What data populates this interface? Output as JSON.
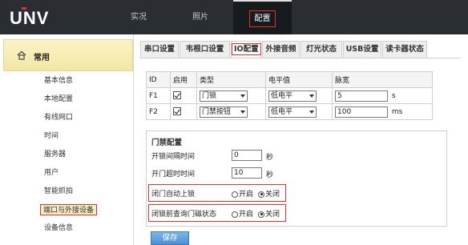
{
  "brand": {
    "logo_text": "UNV",
    "accent": "#e4322b",
    "topbar_bg": "#2a2e33"
  },
  "top_nav": [
    {
      "label": "实况"
    },
    {
      "label": "照片"
    },
    {
      "label": "配置",
      "active": true
    }
  ],
  "sidebar": {
    "header": {
      "icon": "home-icon",
      "label": "常用"
    },
    "items": [
      {
        "label": "基本信息"
      },
      {
        "label": "本地配置"
      },
      {
        "label": "有线网口"
      },
      {
        "label": "时间"
      },
      {
        "label": "服务器"
      },
      {
        "label": "用户"
      },
      {
        "label": "智能抓拍"
      },
      {
        "label": "端口与外接设备",
        "active": true
      },
      {
        "label": "设备信息"
      }
    ]
  },
  "tabs": [
    {
      "label": "串口设置"
    },
    {
      "label": "韦根口设置"
    },
    {
      "label": "IO配置",
      "active": true
    },
    {
      "label": "外接音频"
    },
    {
      "label": "灯光状态"
    },
    {
      "label": "USB设置"
    },
    {
      "label": "读卡器状态"
    }
  ],
  "io_table": {
    "headers": [
      "ID",
      "启用",
      "类型",
      "电平值",
      "脉宽"
    ],
    "rows": [
      {
        "id": "F1",
        "enabled": true,
        "type": "门锁",
        "level": "低电平",
        "pulse": "5",
        "unit": "s"
      },
      {
        "id": "F2",
        "enabled": true,
        "type": "门禁按钮",
        "level": "低电平",
        "pulse": "100",
        "unit": "ms"
      }
    ]
  },
  "access_config": {
    "title": "门禁配置",
    "unlock_interval": {
      "label": "开锁间隔时间",
      "value": "0",
      "unit": "秒"
    },
    "door_open_timeout": {
      "label": "开门超时时间",
      "value": "10",
      "unit": "秒"
    },
    "auto_lock": {
      "label": "闭门自动上锁",
      "on_label": "开启",
      "off_label": "关闭",
      "selected": "off"
    },
    "check_magnet": {
      "label": "闭锁前查询门磁状态",
      "on_label": "开启",
      "off_label": "关闭",
      "selected": "off"
    }
  },
  "save_label": "保存"
}
